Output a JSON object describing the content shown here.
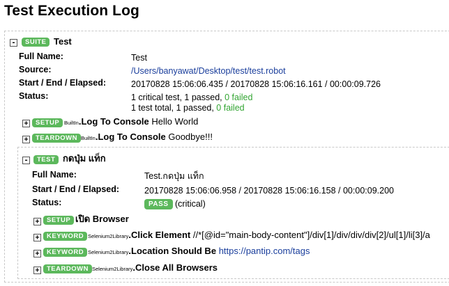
{
  "page": {
    "title": "Test Execution Log"
  },
  "suite": {
    "type_label": "SUITE",
    "name": "Test",
    "toggle": "-",
    "meta": {
      "full_name_label": "Full Name:",
      "full_name": "Test",
      "source_label": "Source:",
      "source": "/Users/banyawat/Desktop/test/test.robot",
      "timing_label": "Start / End / Elapsed:",
      "timing": "20170828 15:06:06.435 / 20170828 15:06:16.161 / 00:00:09.726",
      "status_label": "Status:",
      "status_line1_prefix": "1 critical test, 1 passed, ",
      "status_line1_failed": "0 failed",
      "status_line2_prefix": "1 test total, 1 passed, ",
      "status_line2_failed": "0 failed"
    },
    "keywords": [
      {
        "toggle": "+",
        "type": "SETUP",
        "library": "BuiltIn",
        "name": "Log To Console",
        "args": "Hello World"
      },
      {
        "toggle": "+",
        "type": "TEARDOWN",
        "library": "BuiltIn",
        "name": "Log To Console",
        "args": "Goodbye!!!"
      }
    ]
  },
  "test": {
    "toggle": "-",
    "type_label": "TEST",
    "name": "กดปุ่ม แท็ก",
    "meta": {
      "full_name_label": "Full Name:",
      "full_name": "Test.กดปุ่ม แท็ก",
      "timing_label": "Start / End / Elapsed:",
      "timing": "20170828 15:06:06.958 / 20170828 15:06:16.158 / 00:00:09.200",
      "status_label": "Status:",
      "status_badge": "PASS",
      "status_text": "(critical)"
    },
    "keywords": [
      {
        "toggle": "+",
        "type": "SETUP",
        "library": "",
        "name": "เปิด Browser",
        "args": ""
      },
      {
        "toggle": "+",
        "type": "KEYWORD",
        "library": "Selenium2Library",
        "name": "Click Element",
        "args": "//*[@id=\"main-body-content\"]/div[1]/div/div/div[2]/ul[1]/li[3]/a"
      },
      {
        "toggle": "+",
        "type": "KEYWORD",
        "library": "Selenium2Library",
        "name": "Location Should Be",
        "args": "https://pantip.com/tags"
      },
      {
        "toggle": "+",
        "type": "TEARDOWN",
        "library": "Selenium2Library",
        "name": "Close All Browsers",
        "args": ""
      }
    ]
  },
  "colors": {
    "label_green": "#5cb85c",
    "pass_green": "#33a533",
    "link_blue": "#1a3e9c"
  }
}
